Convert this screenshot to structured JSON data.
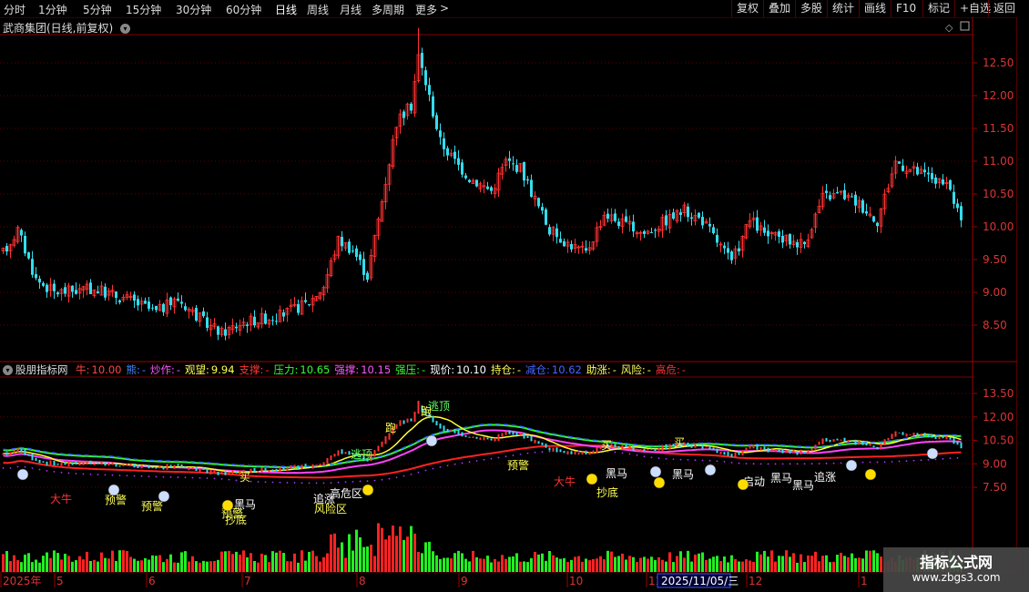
{
  "toolbar": {
    "timeframes": [
      "分时",
      "1分钟",
      "5分钟",
      "15分钟",
      "30分钟",
      "60分钟",
      "日线",
      "周线",
      "月线",
      "多周期",
      "更多"
    ],
    "active_timeframe": "日线",
    "more_glyph": ">",
    "right_buttons": [
      "复权",
      "叠加",
      "多股",
      "统计",
      "画线",
      "F10",
      "标记",
      "+自选",
      "返回"
    ]
  },
  "main_chart": {
    "title": "武商集团(日线,前复权)",
    "price_axis_labels": [
      "12.50",
      "12.00",
      "11.50",
      "11.00",
      "10.50",
      "10.00",
      "9.50",
      "9.00",
      "8.50"
    ]
  },
  "indicator": {
    "name": "股朋指标网",
    "fields": [
      {
        "label": "牛:",
        "value": "10.00",
        "color": "#ff4444"
      },
      {
        "label": "熊:",
        "value": "-",
        "color": "#4488ff"
      },
      {
        "label": "炒作:",
        "value": "-",
        "color": "#ff55ff"
      },
      {
        "label": "观望:",
        "value": "9.94",
        "color": "#ffff55"
      },
      {
        "label": "支撑:",
        "value": "-",
        "color": "#ff3333"
      },
      {
        "label": "压力:",
        "value": "10.65",
        "color": "#33ff33"
      },
      {
        "label": "强撑:",
        "value": "10.15",
        "color": "#ff55ff"
      },
      {
        "label": "强压:",
        "value": "-",
        "color": "#33ff33"
      },
      {
        "label": "现价:",
        "value": "10.10",
        "color": "#ffffff"
      },
      {
        "label": "持仓:",
        "value": "-",
        "color": "#ffff55"
      },
      {
        "label": "减仓:",
        "value": "10.62",
        "color": "#4466ff"
      },
      {
        "label": "助涨:",
        "value": "-",
        "color": "#ffff55"
      },
      {
        "label": "风险:",
        "value": "-",
        "color": "#ffff55"
      },
      {
        "label": "高危:",
        "value": "-",
        "color": "#ff3333"
      }
    ],
    "price_axis_labels": [
      "13.50",
      "12.00",
      "10.50",
      "9.00",
      "7.50"
    ]
  },
  "signals": [
    {
      "text": "逃顶",
      "color": "#66ff66"
    },
    {
      "text": "逃顶",
      "color": "#66ff66"
    },
    {
      "text": "跑",
      "color": "#ffff55"
    },
    {
      "text": "跑",
      "color": "#ffff55"
    },
    {
      "text": "买",
      "color": "#ffff55"
    },
    {
      "text": "买",
      "color": "#ffff55"
    },
    {
      "text": "买",
      "color": "#ffff55"
    },
    {
      "text": "预警",
      "color": "#ffff55"
    },
    {
      "text": "预警",
      "color": "#ffff55"
    },
    {
      "text": "预警",
      "color": "#ffff55"
    },
    {
      "text": "预警",
      "color": "#ffff55"
    },
    {
      "text": "大牛",
      "color": "#ff3333"
    },
    {
      "text": "大牛",
      "color": "#ff3333"
    },
    {
      "text": "黑马",
      "color": "#ffffff"
    },
    {
      "text": "黑马",
      "color": "#ffffff"
    },
    {
      "text": "黑马",
      "color": "#ffffff"
    },
    {
      "text": "黑马",
      "color": "#ffffff"
    },
    {
      "text": "黑马",
      "color": "#ffffff"
    },
    {
      "text": "抄底",
      "color": "#ffff55"
    },
    {
      "text": "抄底",
      "color": "#ffff55"
    },
    {
      "text": "高危区",
      "color": "#ffffff"
    },
    {
      "text": "追涨",
      "color": "#ffffff"
    },
    {
      "text": "追涨",
      "color": "#ffffff"
    },
    {
      "text": "风险区",
      "color": "#ffff55"
    },
    {
      "text": "启动",
      "color": "#ffffff"
    }
  ],
  "time_axis": {
    "labels": [
      "2025年",
      "5",
      "6",
      "7",
      "8",
      "9",
      "10",
      "11",
      "12",
      "1"
    ],
    "cursor_date": "2025/11/05/三"
  },
  "watermark": {
    "title": "指标公式网",
    "url": "www.zbgs3.com"
  },
  "colors": {
    "up": "#ff3333",
    "down": "#33ddee",
    "grid": "#800000",
    "axis_text": "#dd3333"
  }
}
